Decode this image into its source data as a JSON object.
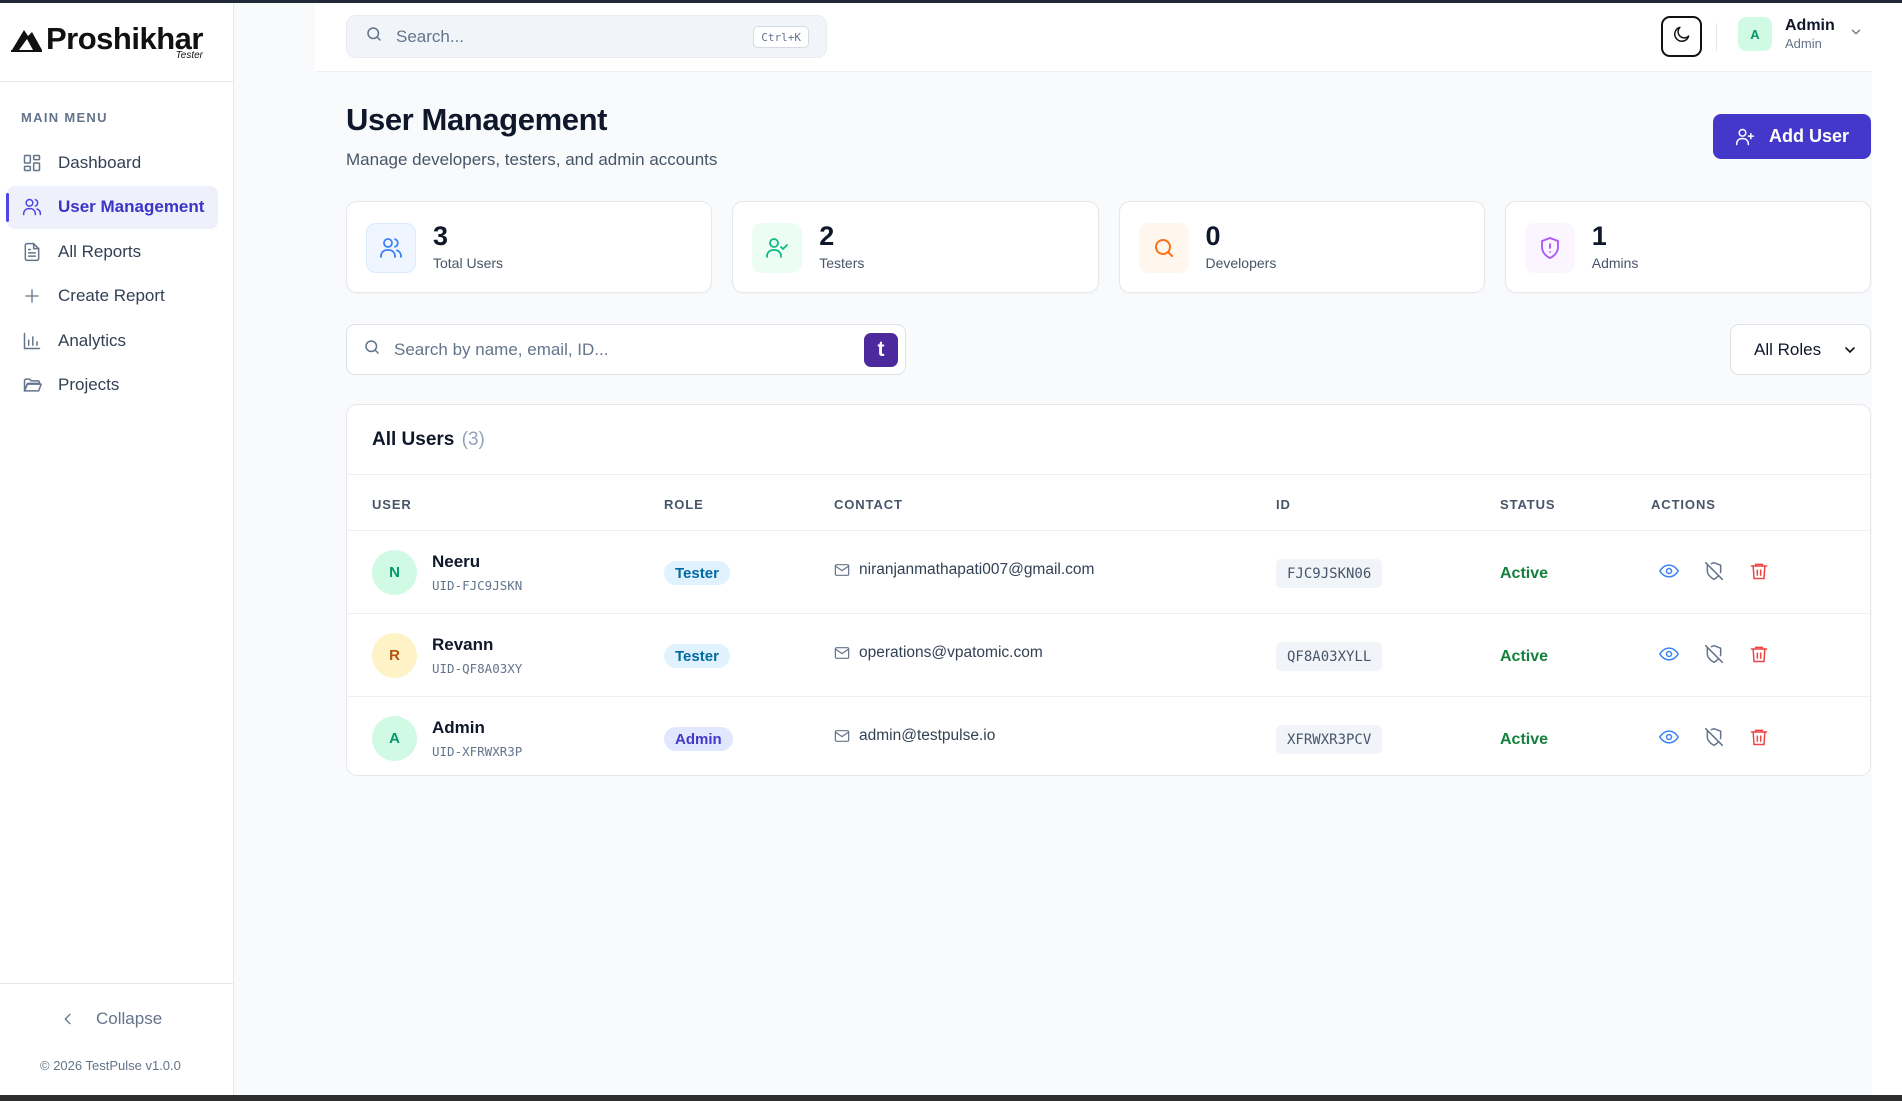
{
  "brand": {
    "name": "Proshikhar",
    "subtitle": "Tester"
  },
  "sidebar": {
    "section_title": "MAIN MENU",
    "items": [
      {
        "label": "Dashboard",
        "icon": "dashboard-grid-icon",
        "active": false
      },
      {
        "label": "User Management",
        "icon": "users-icon",
        "active": true
      },
      {
        "label": "All Reports",
        "icon": "file-text-icon",
        "active": false
      },
      {
        "label": "Create Report",
        "icon": "plus-icon",
        "active": false
      },
      {
        "label": "Analytics",
        "icon": "bar-chart-icon",
        "active": false
      },
      {
        "label": "Projects",
        "icon": "folder-icon",
        "active": false
      }
    ],
    "collapse_label": "Collapse",
    "copyright": "© 2026 TestPulse v1.0.0"
  },
  "topbar": {
    "search_placeholder": "Search...",
    "shortcut": "Ctrl+K",
    "user": {
      "initial": "A",
      "name": "Admin",
      "role": "Admin"
    }
  },
  "page": {
    "title": "User Management",
    "subtitle": "Manage developers, testers, and admin accounts",
    "add_button": "Add User"
  },
  "stats": [
    {
      "value": "3",
      "label": "Total Users",
      "icon": "users-icon",
      "color": "#3b82f6",
      "bg": "#eff6ff"
    },
    {
      "value": "2",
      "label": "Testers",
      "icon": "user-check-icon",
      "color": "#10b981",
      "bg": "#ecfdf5"
    },
    {
      "value": "0",
      "label": "Developers",
      "icon": "search-icon",
      "color": "#f97316",
      "bg": "#fff7ed"
    },
    {
      "value": "1",
      "label": "Admins",
      "icon": "shield-alert-icon",
      "color": "#a855f7",
      "bg": "#faf5ff"
    }
  ],
  "filters": {
    "search_placeholder": "Search by name, email, ID...",
    "badge": "t",
    "role_selected": "All Roles"
  },
  "table": {
    "title": "All Users",
    "count": "(3)",
    "columns": [
      "USER",
      "ROLE",
      "CONTACT",
      "ID",
      "STATUS",
      "ACTIONS"
    ],
    "rows": [
      {
        "initial": "N",
        "name": "Neeru",
        "uid": "UID-FJC9JSKN",
        "role": "Tester",
        "email": "niranjanmathapati007@gmail.com",
        "id": "FJC9JSKN06",
        "status": "Active",
        "avatar_bg": "#d1fae5",
        "avatar_fg": "#059669"
      },
      {
        "initial": "R",
        "name": "Revann",
        "uid": "UID-QF8A03XY",
        "role": "Tester",
        "email": "operations@vpatomic.com",
        "id": "QF8A03XYLL",
        "status": "Active",
        "avatar_bg": "#fef3c7",
        "avatar_fg": "#b45309"
      },
      {
        "initial": "A",
        "name": "Admin",
        "uid": "UID-XFRWXR3P",
        "role": "Admin",
        "email": "admin@testpulse.io",
        "id": "XFRWXR3PCV",
        "status": "Active",
        "avatar_bg": "#d1fae5",
        "avatar_fg": "#059669"
      }
    ]
  },
  "colors": {
    "accent": "#4338ca",
    "tester_pill_bg": "#e0f2fe",
    "tester_pill_fg": "#0369a1",
    "admin_pill_bg": "#e0e7ff",
    "admin_pill_fg": "#4338ca",
    "status_active": "#15803d"
  }
}
